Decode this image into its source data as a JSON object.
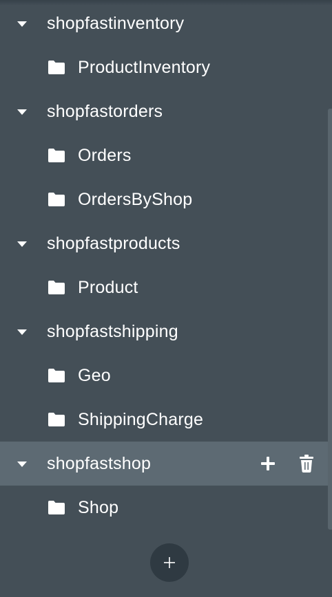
{
  "tree": [
    {
      "database": "shopfastinventory",
      "collections": [
        "ProductInventory"
      ]
    },
    {
      "database": "shopfastorders",
      "collections": [
        "Orders",
        "OrdersByShop"
      ]
    },
    {
      "database": "shopfastproducts",
      "collections": [
        "Product"
      ]
    },
    {
      "database": "shopfastshipping",
      "collections": [
        "Geo",
        "ShippingCharge"
      ]
    },
    {
      "database": "shopfastshop",
      "collections": [
        "Shop"
      ]
    }
  ],
  "icons": {
    "expand": "caret-down-icon",
    "collection": "folder-icon",
    "add_collection": "plus-icon",
    "delete_database": "trash-icon",
    "create_database": "plus-icon"
  },
  "colors": {
    "background": "#444f57",
    "selected_row": "#5d6a73",
    "fab": "#2f3a42",
    "text": "#ffffff"
  }
}
